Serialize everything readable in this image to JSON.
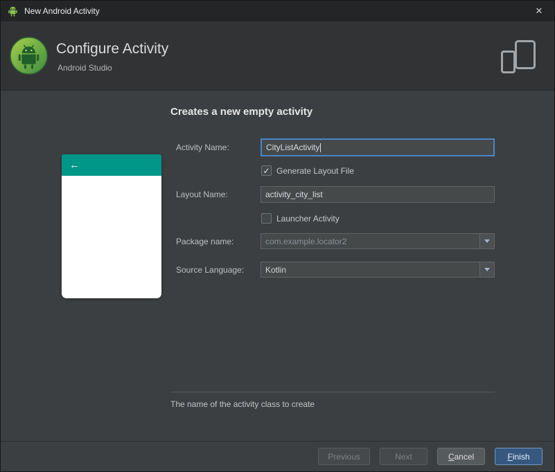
{
  "window": {
    "title": "New Android Activity"
  },
  "icons": {
    "close": "✕",
    "back_arrow": "←"
  },
  "header": {
    "title": "Configure Activity",
    "subtitle": "Android Studio"
  },
  "main": {
    "heading": "Creates a new empty activity",
    "fields": {
      "activity_name": {
        "label": "Activity Name:",
        "value": "CityListActivity"
      },
      "generate_layout_file": {
        "label": "Generate Layout File",
        "checked": true,
        "check_glyph": "✓"
      },
      "layout_name": {
        "label": "Layout Name:",
        "value": "activity_city_list"
      },
      "launcher_activity": {
        "label": "Launcher Activity",
        "checked": false,
        "check_glyph": ""
      },
      "package_name": {
        "label": "Package name:",
        "value": "com.example.locator2"
      },
      "source_language": {
        "label": "Source Language:",
        "value": "Kotlin"
      }
    },
    "status_text": "The name of the activity class to create"
  },
  "footer": {
    "previous": "Previous",
    "next": "Next",
    "cancel_mnemonic": "C",
    "cancel_rest": "ancel",
    "finish_mnemonic": "F",
    "finish_rest": "inish"
  },
  "colors": {
    "preview_teal": "#009688",
    "focus_blue": "#4a88c7",
    "finish_button": "#365880",
    "body_background": "#3c3f41"
  }
}
